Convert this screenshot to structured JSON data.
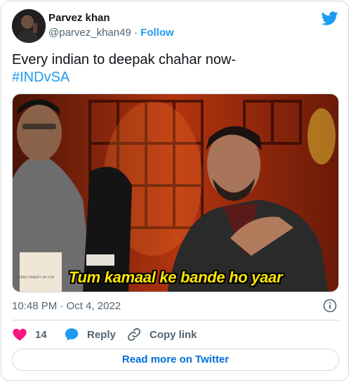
{
  "author": {
    "name": "Parvez khan",
    "handle": "@parvez_khan49",
    "separator": "·",
    "follow_label": "Follow"
  },
  "tweet": {
    "text": "Every indian to deepak chahar now-",
    "hashtag": "#INDvSA",
    "media_caption": "Tum kamaal ke bande ho yaar",
    "media_box_text": "GUDDU PANDEY KA FUN"
  },
  "meta": {
    "time": "10:48 PM",
    "separator": "·",
    "date": "Oct 4, 2022"
  },
  "actions": {
    "likes": "14",
    "reply_label": "Reply",
    "copy_label": "Copy link"
  },
  "read_more_label": "Read more on Twitter",
  "colors": {
    "accent": "#1d9bf0",
    "heart": "#f91880",
    "text_secondary": "#536471",
    "border": "#cfd9de",
    "caption": "#ffe600"
  },
  "icons": [
    "twitter-bird-icon",
    "info-icon",
    "heart-icon",
    "reply-bubble-icon",
    "link-icon"
  ]
}
